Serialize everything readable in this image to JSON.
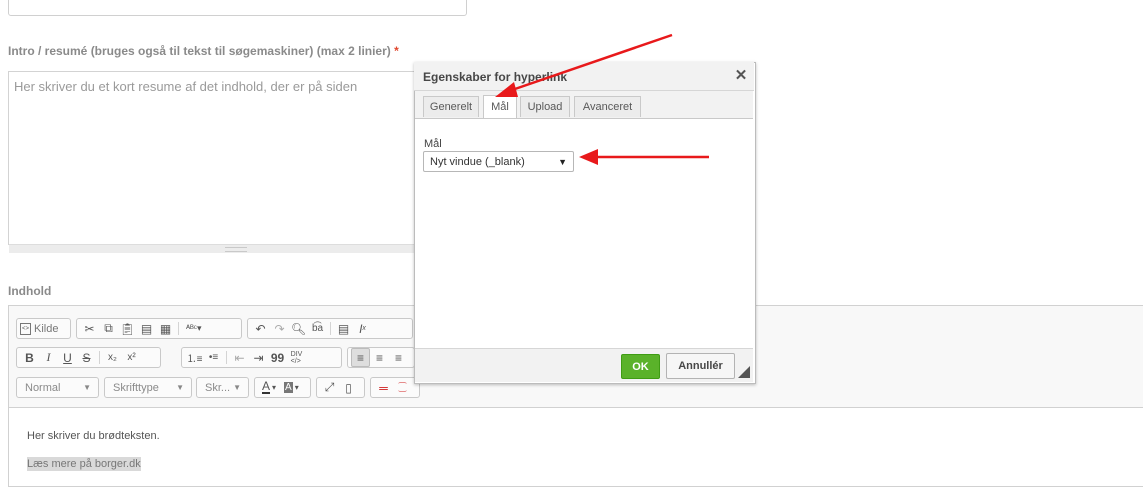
{
  "form": {
    "intro_label": "Intro / resumé (bruges også til tekst til søgemaskiner) (max 2 linier)",
    "required_mark": "*",
    "intro_placeholder": "Her skriver du et kort resume af det indhold, der er på siden",
    "content_label": "Indhold"
  },
  "toolbar": {
    "source_label": "Kilde",
    "format_value": "Normal",
    "font_value": "Skrifttype",
    "size_value": "Skr...",
    "bold": "B",
    "italic": "I",
    "underline": "U",
    "strike": "S",
    "subscript": "x₂",
    "superscript": "x²",
    "quote": "99",
    "text_color": "A",
    "bg_color": "A"
  },
  "editor": {
    "paragraph": "Her skriver du brødteksten.",
    "link_text": "Læs mere på borger.dk"
  },
  "dialog": {
    "title": "Egenskaber for hyperlink",
    "tabs": [
      {
        "label": "Generelt",
        "active": false
      },
      {
        "label": "Mål",
        "active": true
      },
      {
        "label": "Upload",
        "active": false
      },
      {
        "label": "Avanceret",
        "active": false
      }
    ],
    "target_label": "Mål",
    "target_value": "Nyt vindue (_blank)",
    "ok_label": "OK",
    "cancel_label": "Annullér"
  },
  "colors": {
    "annotation_arrow": "#e8191b",
    "ok_button": "#5ab22a",
    "required": "#e0472e"
  }
}
